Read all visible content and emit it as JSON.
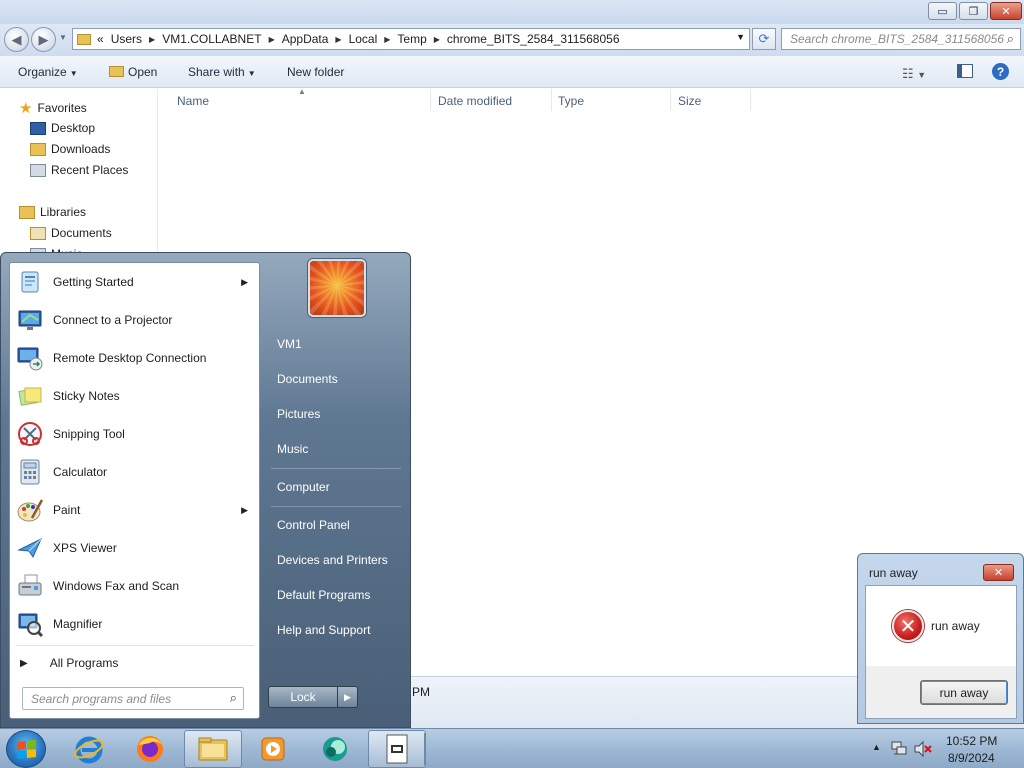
{
  "window": {
    "buttons": {
      "minimize": "▭",
      "maximize": "❐",
      "close": "✕"
    }
  },
  "address": {
    "overflow": "«",
    "crumbs": [
      "Users",
      "VM1.COLLABNET",
      "AppData",
      "Local",
      "Temp",
      "chrome_BITS_2584_311568056"
    ],
    "search_placeholder": "Search chrome_BITS_2584_311568056"
  },
  "toolbar": {
    "organize": "Organize",
    "open": "Open",
    "share_with": "Share with",
    "new_folder": "New folder"
  },
  "nav": {
    "favorites": "Favorites",
    "favorites_items": [
      "Desktop",
      "Downloads",
      "Recent Places"
    ],
    "libraries": "Libraries",
    "libraries_items": [
      "Documents",
      "Music"
    ]
  },
  "columns": [
    "Name",
    "Date modified",
    "Type",
    "Size"
  ],
  "status": {
    "text": "PM"
  },
  "start_menu": {
    "programs": [
      {
        "label": "Getting Started",
        "has_submenu": true,
        "icon": "getting-started-icon"
      },
      {
        "label": "Connect to a Projector",
        "has_submenu": false,
        "icon": "projector-icon"
      },
      {
        "label": "Remote Desktop Connection",
        "has_submenu": false,
        "icon": "remote-desktop-icon"
      },
      {
        "label": "Sticky Notes",
        "has_submenu": false,
        "icon": "sticky-notes-icon"
      },
      {
        "label": "Snipping Tool",
        "has_submenu": false,
        "icon": "snipping-tool-icon"
      },
      {
        "label": "Calculator",
        "has_submenu": false,
        "icon": "calculator-icon"
      },
      {
        "label": "Paint",
        "has_submenu": true,
        "icon": "paint-icon"
      },
      {
        "label": "XPS Viewer",
        "has_submenu": false,
        "icon": "xps-viewer-icon"
      },
      {
        "label": "Windows Fax and Scan",
        "has_submenu": false,
        "icon": "fax-scan-icon"
      },
      {
        "label": "Magnifier",
        "has_submenu": false,
        "icon": "magnifier-icon"
      }
    ],
    "all_programs": "All Programs",
    "search_placeholder": "Search programs and files",
    "right_items": [
      "VM1",
      "Documents",
      "Pictures",
      "Music",
      "Computer",
      "Control Panel",
      "Devices and Printers",
      "Default Programs",
      "Help and Support"
    ],
    "lock": "Lock"
  },
  "taskbar": {
    "apps": [
      "internet-explorer-icon",
      "firefox-icon",
      "file-explorer-icon",
      "media-player-icon",
      "bits-app-icon",
      "dialog-app-icon"
    ],
    "time": "10:52 PM",
    "date": "8/9/2024"
  },
  "dialog": {
    "title": "run away",
    "message": "run away",
    "button": "run away",
    "close": "✕"
  },
  "colors": {
    "accent": "#2d6cc0",
    "error": "#c81e1e"
  }
}
